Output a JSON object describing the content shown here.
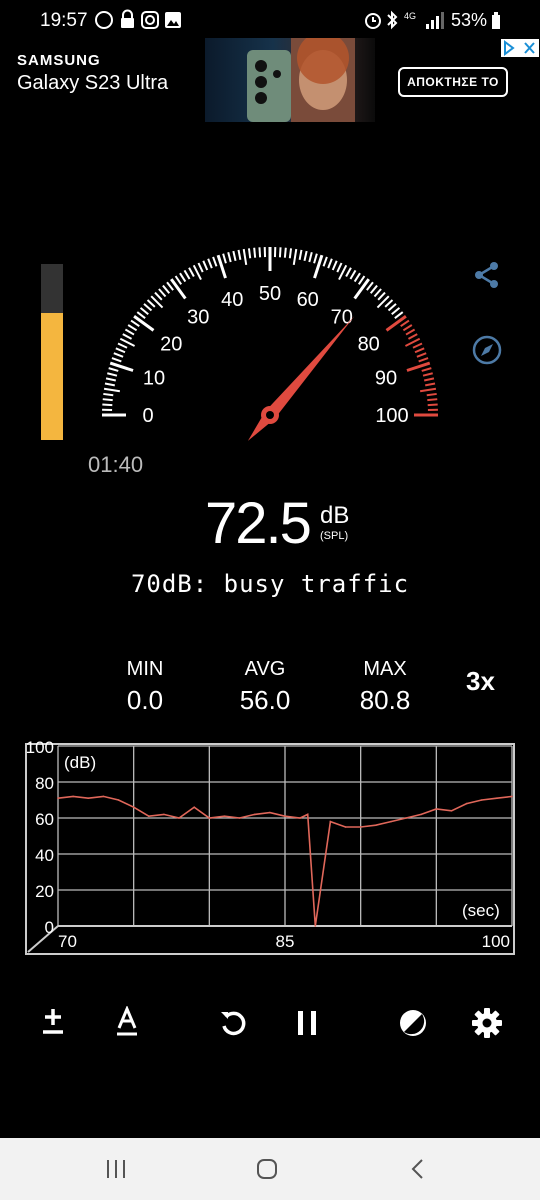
{
  "status_bar": {
    "time": "19:57",
    "battery": "53%",
    "network": "4G"
  },
  "ad": {
    "brand": "SAMSUNG",
    "product": "Galaxy S23 Ultra",
    "cta": "ΑΠΟΚΤΗΣΕ ΤΟ"
  },
  "meter": {
    "level_fraction": 0.72,
    "gauge_min": 0,
    "gauge_max": 100,
    "needle_value": 72.5,
    "gauge_labels": [
      "0",
      "10",
      "20",
      "30",
      "40",
      "50",
      "60",
      "70",
      "80",
      "90",
      "100"
    ],
    "red_zone_start": 80,
    "timer": "01:40",
    "value": "72.5",
    "unit": "dB",
    "unit_sub": "(SPL)",
    "reference": "70dB: busy traffic",
    "accent_color": "#e04a3f",
    "level_color": "#f4b63f"
  },
  "stats": {
    "min_label": "MIN",
    "min_value": "0.0",
    "avg_label": "AVG",
    "avg_value": "56.0",
    "max_label": "MAX",
    "max_value": "80.8"
  },
  "zoom": "3x",
  "chart_data": {
    "type": "line",
    "ylabel": "(dB)",
    "xlabel": "(sec)",
    "ylim": [
      0,
      100
    ],
    "xlim": [
      70,
      100
    ],
    "y_ticks": [
      "0",
      "20",
      "40",
      "60",
      "80",
      "100"
    ],
    "x_ticks": [
      "70",
      "85",
      "100"
    ],
    "grid": true,
    "series": [
      {
        "x": [
          70,
          71,
          72,
          73,
          74,
          75,
          76,
          77,
          78,
          79,
          80,
          81,
          82,
          83,
          84,
          85,
          86,
          86.5,
          87,
          88,
          89,
          90,
          91,
          92,
          93,
          94,
          95,
          96,
          97,
          98,
          99,
          100
        ],
        "values": [
          71,
          72,
          71,
          72,
          70,
          66,
          61,
          62,
          60,
          66,
          60,
          61,
          60,
          62,
          63,
          61,
          60,
          62,
          0,
          58,
          55,
          55,
          56,
          58,
          60,
          62,
          65,
          64,
          68,
          70,
          71,
          72
        ]
      }
    ]
  },
  "toolbar": {
    "calibrate_icon": "plus-minus-icon",
    "weighting_icon": "a-weighting-icon",
    "reset_icon": "reset-icon",
    "pause_icon": "pause-icon",
    "theme_icon": "contrast-icon",
    "settings_icon": "gear-icon"
  }
}
